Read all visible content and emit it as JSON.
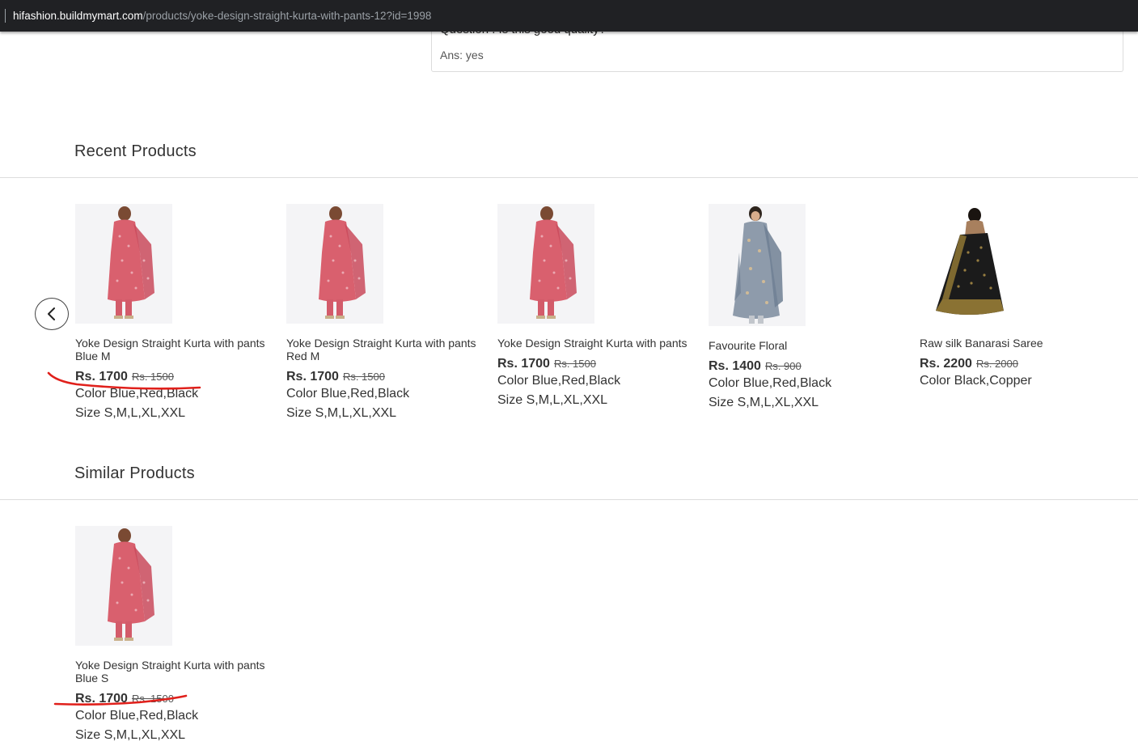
{
  "browser": {
    "url_host": "hifashion.buildmymart.com",
    "url_path": "/products/yoke-design-straight-kurta-with-pants-12?id=1998"
  },
  "qa": {
    "question": "Question : Is this good quality?",
    "answer": "Ans: yes"
  },
  "recent": {
    "title": "Recent Products",
    "nav_prev_icon": "chevron-left-icon",
    "products": [
      {
        "name": "Yoke Design Straight Kurta with pants Blue M",
        "price": "Rs. 1700",
        "old_price": "Rs. 1500",
        "color": "Color Blue,Red,Black",
        "size": "Size S,M,L,XL,XXL",
        "image": "pink-kurta-icon"
      },
      {
        "name": "Yoke Design Straight Kurta with pants Red M",
        "price": "Rs. 1700",
        "old_price": "Rs. 1500",
        "color": "Color Blue,Red,Black",
        "size": "Size S,M,L,XL,XXL",
        "image": "pink-kurta-icon"
      },
      {
        "name": "Yoke Design Straight Kurta with pants",
        "price": "Rs. 1700",
        "old_price": "Rs. 1500",
        "color": "Color Blue,Red,Black",
        "size": "Size S,M,L,XL,XXL",
        "image": "pink-kurta-icon"
      },
      {
        "name": "Favourite Floral",
        "price": "Rs. 1400",
        "old_price": "Rs. 900",
        "color": "Color Blue,Red,Black",
        "size": "Size S,M,L,XL,XXL",
        "image": "grey-floral-suit-icon"
      },
      {
        "name": "Raw silk Banarasi Saree",
        "price": "Rs. 2200",
        "old_price": "Rs. 2000",
        "color": "Color Black,Copper",
        "size": "",
        "image": "black-saree-icon"
      }
    ]
  },
  "similar": {
    "title": "Similar Products",
    "products": [
      {
        "name": "Yoke Design Straight Kurta with pants Blue S",
        "price": "Rs. 1700",
        "old_price": "Rs. 1500",
        "color": "Color Blue,Red,Black",
        "size": "Size S,M,L,XL,XXL",
        "image": "pink-kurta-icon"
      }
    ]
  },
  "colors": {
    "annotation": "#e0201b",
    "kurta": "#d9606e",
    "floral": "#8e9bab",
    "saree": "#1b1b1b"
  }
}
